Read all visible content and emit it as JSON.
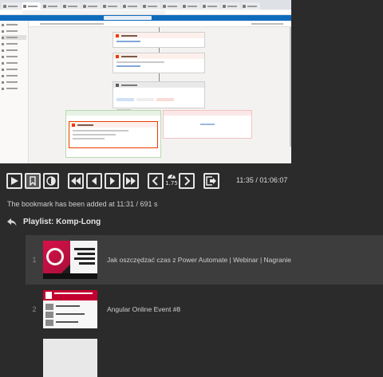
{
  "controls": {
    "speed": "1.75",
    "timecode": "11:35 / 01:06:07"
  },
  "status_message": "The bookmark has been added at 11:31 / 691 s",
  "playlist": {
    "title": "Playlist: Komp-Long",
    "items": [
      {
        "num": "1",
        "title": "Jak oszczędzać czas z Power Automate | Webinar | Nagranie"
      },
      {
        "num": "2",
        "title": "Angular Online Event #8"
      }
    ]
  },
  "colors": {
    "background": "#2b2b2b",
    "current_row": "#3d3d3d",
    "flow_accent": "#eb3c00",
    "app_header": "#0f6cbd"
  },
  "icons": {
    "play": "play-icon",
    "bookmark": "bookmark-icon",
    "contrast": "contrast-icon",
    "rewind": "rewind-icon",
    "prev_frame": "step-back-icon",
    "next_frame": "step-forward-icon",
    "fast_forward": "fast-forward-icon",
    "speed_down": "chevron-left-icon",
    "speed": "speedometer-icon",
    "speed_up": "chevron-right-icon",
    "exit": "exit-icon",
    "back": "reply-arrow-icon"
  }
}
